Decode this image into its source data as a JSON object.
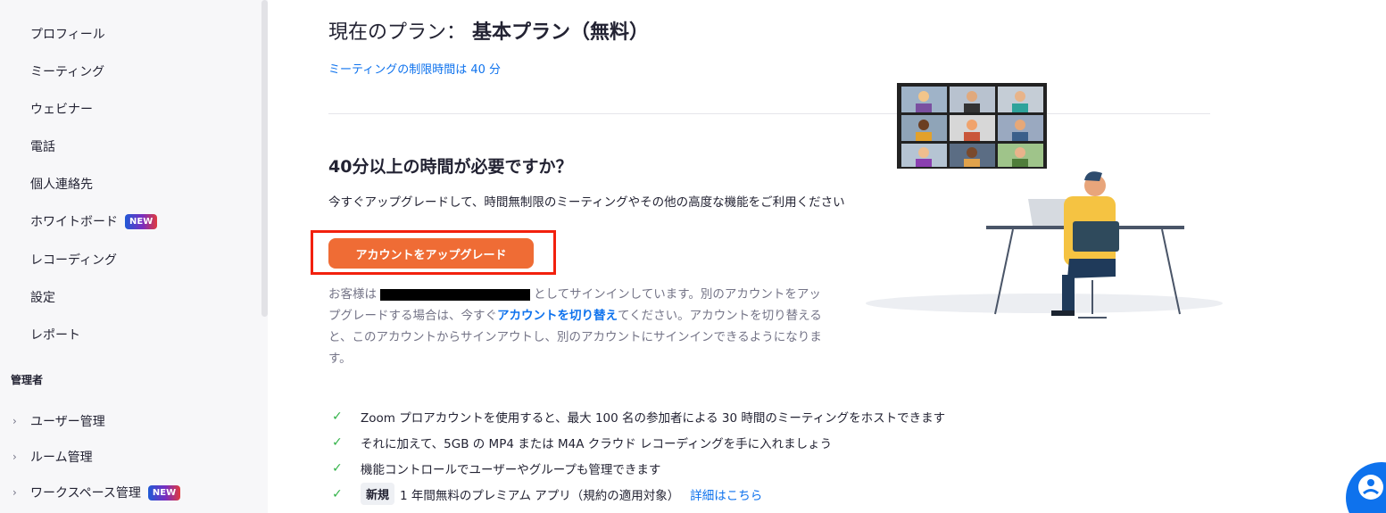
{
  "sidebar": {
    "items": [
      {
        "label": "プロフィール"
      },
      {
        "label": "ミーティング"
      },
      {
        "label": "ウェビナー"
      },
      {
        "label": "電話"
      },
      {
        "label": "個人連絡先"
      },
      {
        "label": "ホワイトボード",
        "badge": "NEW"
      },
      {
        "label": "レコーディング"
      },
      {
        "label": "設定"
      },
      {
        "label": "レポート"
      }
    ],
    "admin_label": "管理者",
    "admin_items": [
      {
        "label": "ユーザー管理"
      },
      {
        "label": "ルーム管理"
      },
      {
        "label": "ワークスペース管理",
        "badge": "NEW"
      }
    ]
  },
  "main": {
    "plan_prefix": "現在のプラン：",
    "plan_name": "基本プラン（無料）",
    "limit_text": "ミーティングの制限時間は 40 分",
    "need_title": "40分以上の時間が必要ですか？",
    "need_desc": "今すぐアップグレードして、時間無制限のミーティングやその他の高度な機能をご利用ください",
    "upgrade_button": "アカウントをアップグレード",
    "signin_pre": "お客様は",
    "signin_mid": "としてサインインしています。別のアカウントをアップグレードする場合は、今すぐ",
    "switch_link": "アカウントを切り替え",
    "signin_post": "てください。アカウントを切り替えると、このアカウントからサインアウトし、別のアカウントにサインインできるようになります。",
    "features": [
      {
        "text": "Zoom プロアカウントを使用すると、最大 100 名の参加者による 30 時間のミーティングをホストできます"
      },
      {
        "text": "それに加えて、5GB の MP4 または M4A クラウド レコーディングを手に入れましょう"
      },
      {
        "text": "機能コントロールでユーザーやグループも管理できます"
      },
      {
        "tag": "新規",
        "text": "1 年間無料のプレミアム アプリ（規約の適用対象）",
        "link": "詳細はこちら"
      }
    ]
  },
  "colors": {
    "accent_blue": "#0e72ed",
    "upgrade_orange": "#ef6c35",
    "highlight_red": "#f2200d",
    "check_green": "#34b34a"
  }
}
